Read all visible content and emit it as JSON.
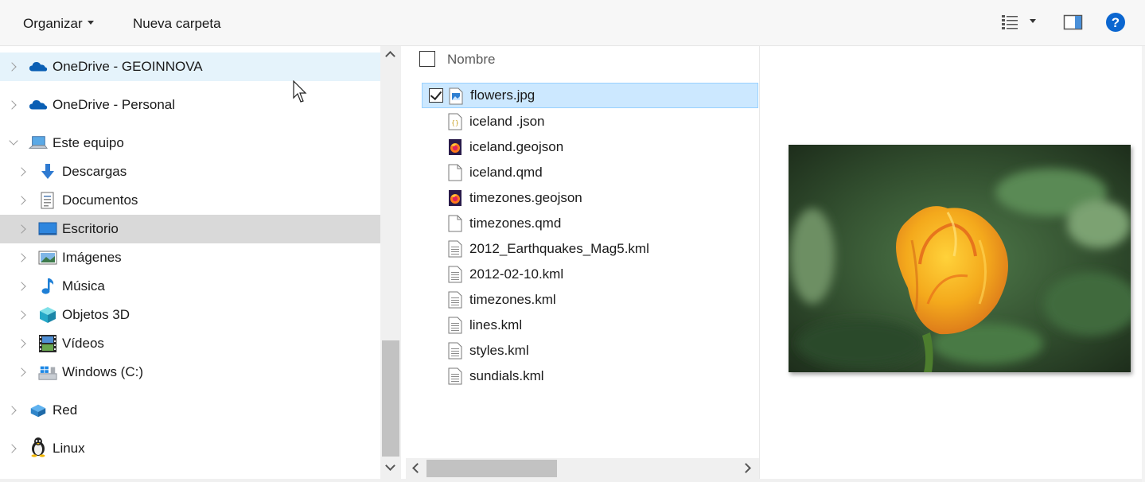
{
  "toolbar": {
    "organize_label": "Organizar",
    "new_folder_label": "Nueva carpeta",
    "help_label": "?"
  },
  "nav": {
    "items": [
      {
        "label": "OneDrive - GEOINNOVA",
        "icon": "onedrive-cloud-icon",
        "state": "hover"
      },
      {
        "label": "OneDrive - Personal",
        "icon": "onedrive-cloud-icon"
      },
      {
        "label": "Este equipo",
        "icon": "computer-icon",
        "expanded": true
      },
      {
        "label": "Descargas",
        "icon": "downloads-arrow-icon"
      },
      {
        "label": "Documentos",
        "icon": "documents-icon"
      },
      {
        "label": "Escritorio",
        "icon": "desktop-icon",
        "state": "selected"
      },
      {
        "label": "Imágenes",
        "icon": "pictures-icon"
      },
      {
        "label": "Música",
        "icon": "music-note-icon"
      },
      {
        "label": "Objetos 3D",
        "icon": "3d-objects-icon"
      },
      {
        "label": "Vídeos",
        "icon": "videos-filmstrip-icon"
      },
      {
        "label": "Windows (C:)",
        "icon": "windows-drive-icon"
      },
      {
        "label": "Red",
        "icon": "network-icon"
      },
      {
        "label": "Linux",
        "icon": "linux-tux-icon"
      }
    ]
  },
  "files": {
    "column_name": "Nombre",
    "rows": [
      {
        "name": "flowers.jpg",
        "icon": "image-file-icon",
        "selected": true
      },
      {
        "name": "iceland .json",
        "icon": "json-file-icon"
      },
      {
        "name": "iceland.geojson",
        "icon": "firefox-file-icon"
      },
      {
        "name": "iceland.qmd",
        "icon": "blank-file-icon"
      },
      {
        "name": "timezones.geojson",
        "icon": "firefox-file-icon"
      },
      {
        "name": "timezones.qmd",
        "icon": "blank-file-icon"
      },
      {
        "name": "2012_Earthquakes_Mag5.kml",
        "icon": "text-file-icon"
      },
      {
        "name": "2012-02-10.kml",
        "icon": "text-file-icon"
      },
      {
        "name": "timezones.kml",
        "icon": "text-file-icon"
      },
      {
        "name": "lines.kml",
        "icon": "text-file-icon"
      },
      {
        "name": "styles.kml",
        "icon": "text-file-icon"
      },
      {
        "name": "sundials.kml",
        "icon": "text-file-icon"
      }
    ]
  },
  "preview": {
    "subject": "orange-yellow tulip photo"
  },
  "colors": {
    "hover": "#e5f3fb",
    "selected_nav": "#d9d9d9",
    "selected_file": "#cce8ff",
    "accent": "#0078d7"
  }
}
